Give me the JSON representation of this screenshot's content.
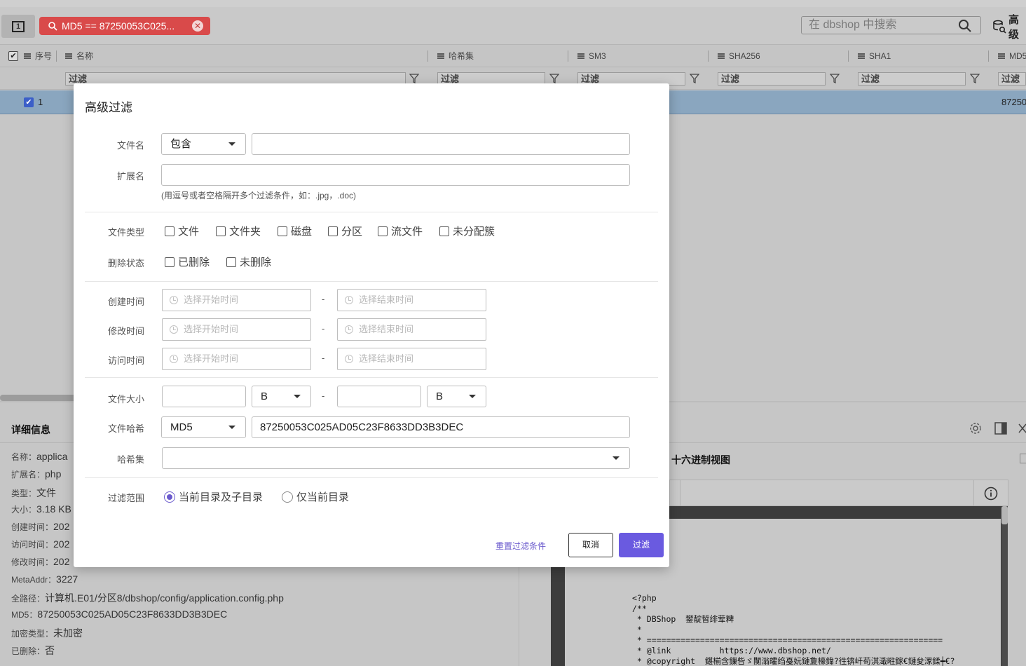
{
  "toolbar": {
    "toggle_label": "1",
    "filter_tag": "MD5 == 87250053C025...",
    "search_placeholder": "在 dbshop 中搜索",
    "advanced_label": "高级"
  },
  "table": {
    "columns": [
      "序号",
      "名称",
      "哈希集",
      "SM3",
      "SHA256",
      "SHA1",
      "MD5"
    ],
    "filter_placeholder": "过滤",
    "row": {
      "no": "1",
      "md5_partial": "87250"
    }
  },
  "details": {
    "title": "详细信息",
    "fields": [
      {
        "k": "名称：",
        "v": "applica"
      },
      {
        "k": "扩展名：",
        "v": "php"
      },
      {
        "k": "类型：",
        "v": "文件"
      },
      {
        "k": "大小：",
        "v": "3.18 KB"
      },
      {
        "k": "创建时间：",
        "v": "202"
      },
      {
        "k": "访问时间：",
        "v": "202"
      },
      {
        "k": "修改时间：",
        "v": "202"
      },
      {
        "k": "MetaAddr：",
        "v": "3227"
      },
      {
        "k": "全路径：",
        "v": "计算机.E01/分区8/dbshop/config/application.config.php"
      },
      {
        "k": "MD5：",
        "v": "87250053C025AD05C23F8633DD3B3DEC"
      },
      {
        "k": "加密类型：",
        "v": "未加密"
      },
      {
        "k": "已删除：",
        "v": "否"
      }
    ]
  },
  "hex": {
    "title": "十六进制视图",
    "code": "<?php\n/**\n * DBShop  鐢靛晢绯荤粺\n *\n * =============================================================\n * @link          https://www.dbshop.net/\n * @copyright  鍖椾含鏁呰ゞ闃滃皬绉戞妧鏈夐檺鍏?徃锛屽苟淇濈暀鎵€鏈夋潈鍒┿€?"
  },
  "modal": {
    "title": "高级过滤",
    "filename": {
      "label": "文件名",
      "mode": "包含",
      "value": ""
    },
    "ext": {
      "label": "扩展名",
      "value": "",
      "hint": "(用逗号或者空格隔开多个过滤条件，如：.jpg，.doc)"
    },
    "file_type": {
      "label": "文件类型",
      "options": [
        "文件",
        "文件夹",
        "磁盘",
        "分区",
        "流文件",
        "未分配簇"
      ]
    },
    "delete_state": {
      "label": "删除状态",
      "options": [
        "已删除",
        "未删除"
      ]
    },
    "times": [
      {
        "label": "创建时间",
        "start": "选择开始时间",
        "end": "选择结束时间"
      },
      {
        "label": "修改时间",
        "start": "选择开始时间",
        "end": "选择结束时间"
      },
      {
        "label": "访问时间",
        "start": "选择开始时间",
        "end": "选择结束时间"
      }
    ],
    "range_sep": "-",
    "size": {
      "label": "文件大小",
      "unit_from": "B",
      "unit_to": "B"
    },
    "hash": {
      "label": "文件哈希",
      "algo": "MD5",
      "value": "87250053C025AD05C23F8633DD3B3DEC"
    },
    "hashset": {
      "label": "哈希集",
      "value": ""
    },
    "scope": {
      "label": "过滤范围",
      "options": [
        "当前目录及子目录",
        "仅当前目录"
      ],
      "selected": 0
    },
    "reset": "重置过滤条件",
    "cancel": "取消",
    "ok": "过滤"
  },
  "colors": {
    "accent": "#6a5ae0",
    "tag": "#d94a4a",
    "selected_row": "#8aa6bf"
  }
}
